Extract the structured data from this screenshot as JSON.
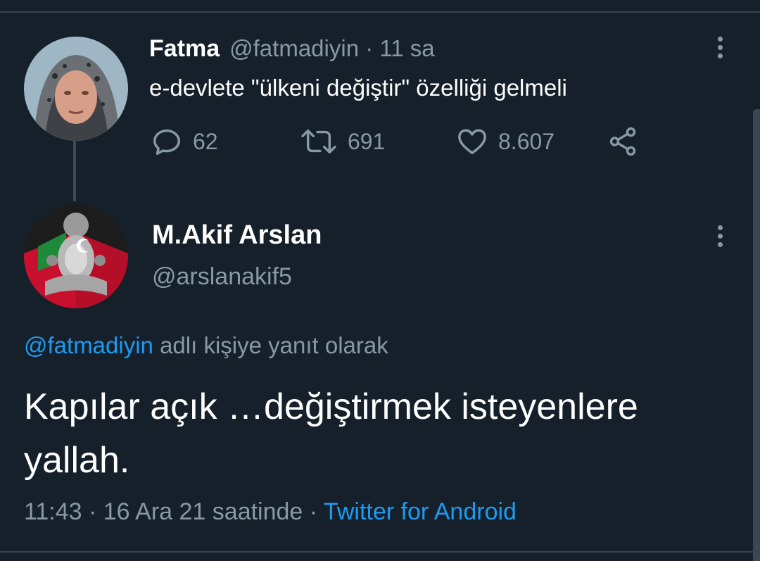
{
  "original_tweet": {
    "author_name": "Fatma",
    "handle_time": "@fatmadiyin · 11 sa",
    "text": "e-devlete \"ülkeni değiştir\" özelliği gelmeli",
    "replies": "62",
    "retweets": "691",
    "likes": "8.607"
  },
  "reply_tweet": {
    "author_name": "M.Akif Arslan",
    "handle": "@arslanakif5",
    "reply_to_mention": "@fatmadiyin",
    "reply_to_suffix": " adlı kişiye yanıt olarak",
    "text": "Kapılar açık …değiştirmek isteyenlere yallah.",
    "timestamp": "11:43 · 16 Ara 21 saatinde · ",
    "source": "Twitter for Android"
  },
  "colors": {
    "background": "#15202b",
    "secondary_text": "#8899a6",
    "link": "#1d9bf0"
  },
  "icons": [
    "reply-icon",
    "retweet-icon",
    "like-icon",
    "share-icon",
    "more-options-icon"
  ]
}
